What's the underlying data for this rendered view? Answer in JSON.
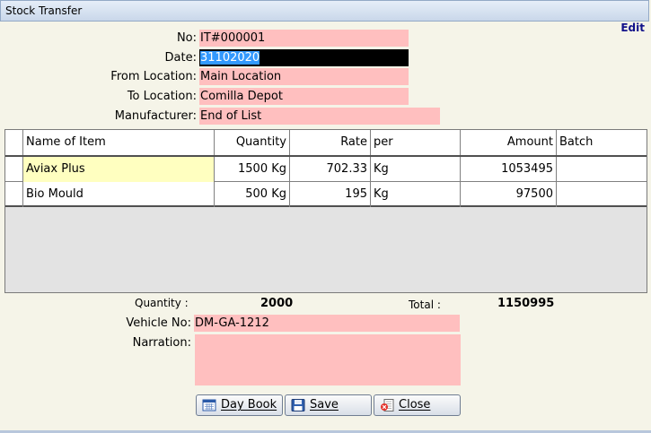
{
  "window": {
    "title": "Stock Transfer",
    "mode": "Edit"
  },
  "form": {
    "no_label": "No:",
    "no_value": "IT#000001",
    "date_label": "Date:",
    "date_value": "31102020",
    "from_label": "From Location:",
    "from_value": "Main Location",
    "to_label": "To Location:",
    "to_value": "Comilla Depot",
    "mfr_label": "Manufacturer:",
    "mfr_value": "End of List"
  },
  "table": {
    "headers": {
      "name": "Name of Item",
      "qty": "Quantity",
      "rate": "Rate",
      "per": "per",
      "amount": "Amount",
      "batch": "Batch"
    },
    "rows": [
      {
        "name": "Aviax Plus",
        "qty": "1500 Kg",
        "rate": "702.33",
        "per": "Kg",
        "amount": "1053495",
        "batch": ""
      },
      {
        "name": "Bio Mould",
        "qty": "500 Kg",
        "rate": "195",
        "per": "Kg",
        "amount": "97500",
        "batch": ""
      }
    ]
  },
  "summary": {
    "qty_label": "Quantity :",
    "qty_value": "2000",
    "total_label": "Total :",
    "total_value": "1150995"
  },
  "extra": {
    "vehicle_label": "Vehicle No:",
    "vehicle_value": "DM-GA-1212",
    "narration_label": "Narration:",
    "narration_value": ""
  },
  "buttons": {
    "daybook": "Day Book",
    "save": "Save",
    "close": "Close"
  },
  "colors": {
    "field_bg": "#ffbfbf",
    "highlight": "#ffffc0",
    "selection": "#3399ff",
    "edit_text": "#12128a"
  },
  "icons": {
    "daybook": "calendar-icon",
    "save": "floppy-disk-icon",
    "close": "close-document-icon"
  }
}
